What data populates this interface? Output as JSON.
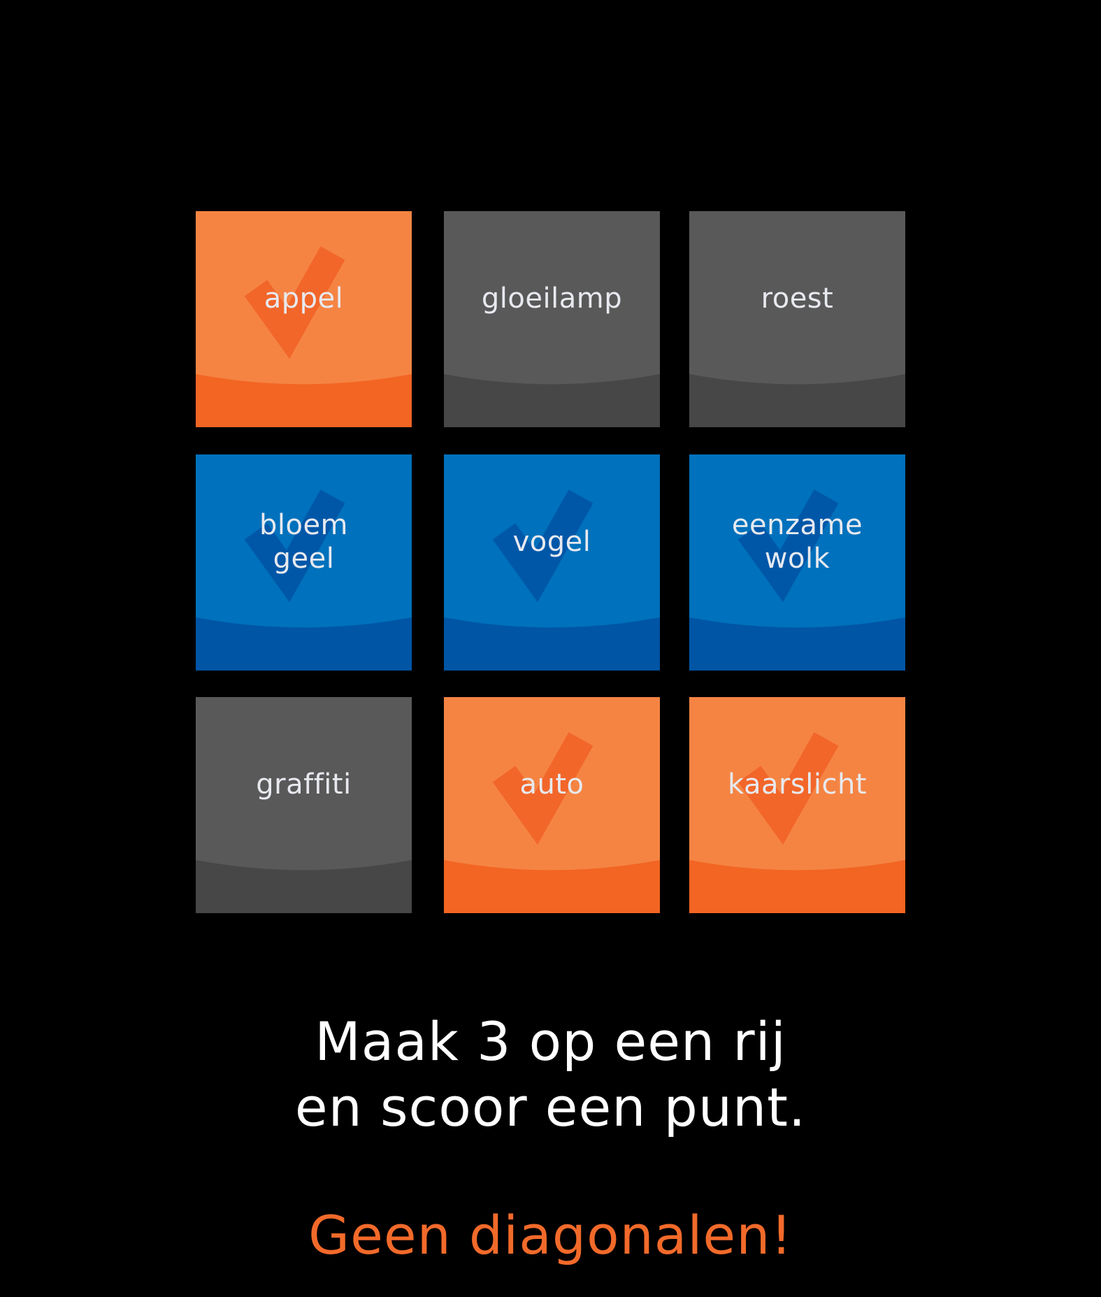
{
  "colors": {
    "background": "#000000",
    "orange": "#f58443",
    "orange_dark": "#f26522",
    "orange_check": "#f2662a",
    "blue": "#0071bc",
    "blue_dark": "#0055a5",
    "blue_check": "#0057a8",
    "grey": "#595959",
    "grey_dark": "#474747",
    "label_text": "#e7e9ef",
    "instruction_text": "#ffffff",
    "warning_text": "#f26a2a"
  },
  "board": {
    "rows": 3,
    "columns": 3,
    "tiles": [
      {
        "label": "appel",
        "color": "orange",
        "checked": true
      },
      {
        "label": "gloeilamp",
        "color": "grey",
        "checked": false
      },
      {
        "label": "roest",
        "color": "grey",
        "checked": false
      },
      {
        "label": "bloem\ngeel",
        "color": "blue",
        "checked": true
      },
      {
        "label": "vogel",
        "color": "blue",
        "checked": true
      },
      {
        "label": "eenzame\nwolk",
        "color": "blue",
        "checked": true
      },
      {
        "label": "graffiti",
        "color": "grey",
        "checked": false
      },
      {
        "label": "auto",
        "color": "orange",
        "checked": true
      },
      {
        "label": "kaarslicht",
        "color": "orange",
        "checked": true
      }
    ]
  },
  "instructions": {
    "line1": "Maak 3 op een rij",
    "line2": "en scoor een punt."
  },
  "warning": "Geen diagonalen!",
  "icons": {
    "check": "checkmark-icon"
  }
}
